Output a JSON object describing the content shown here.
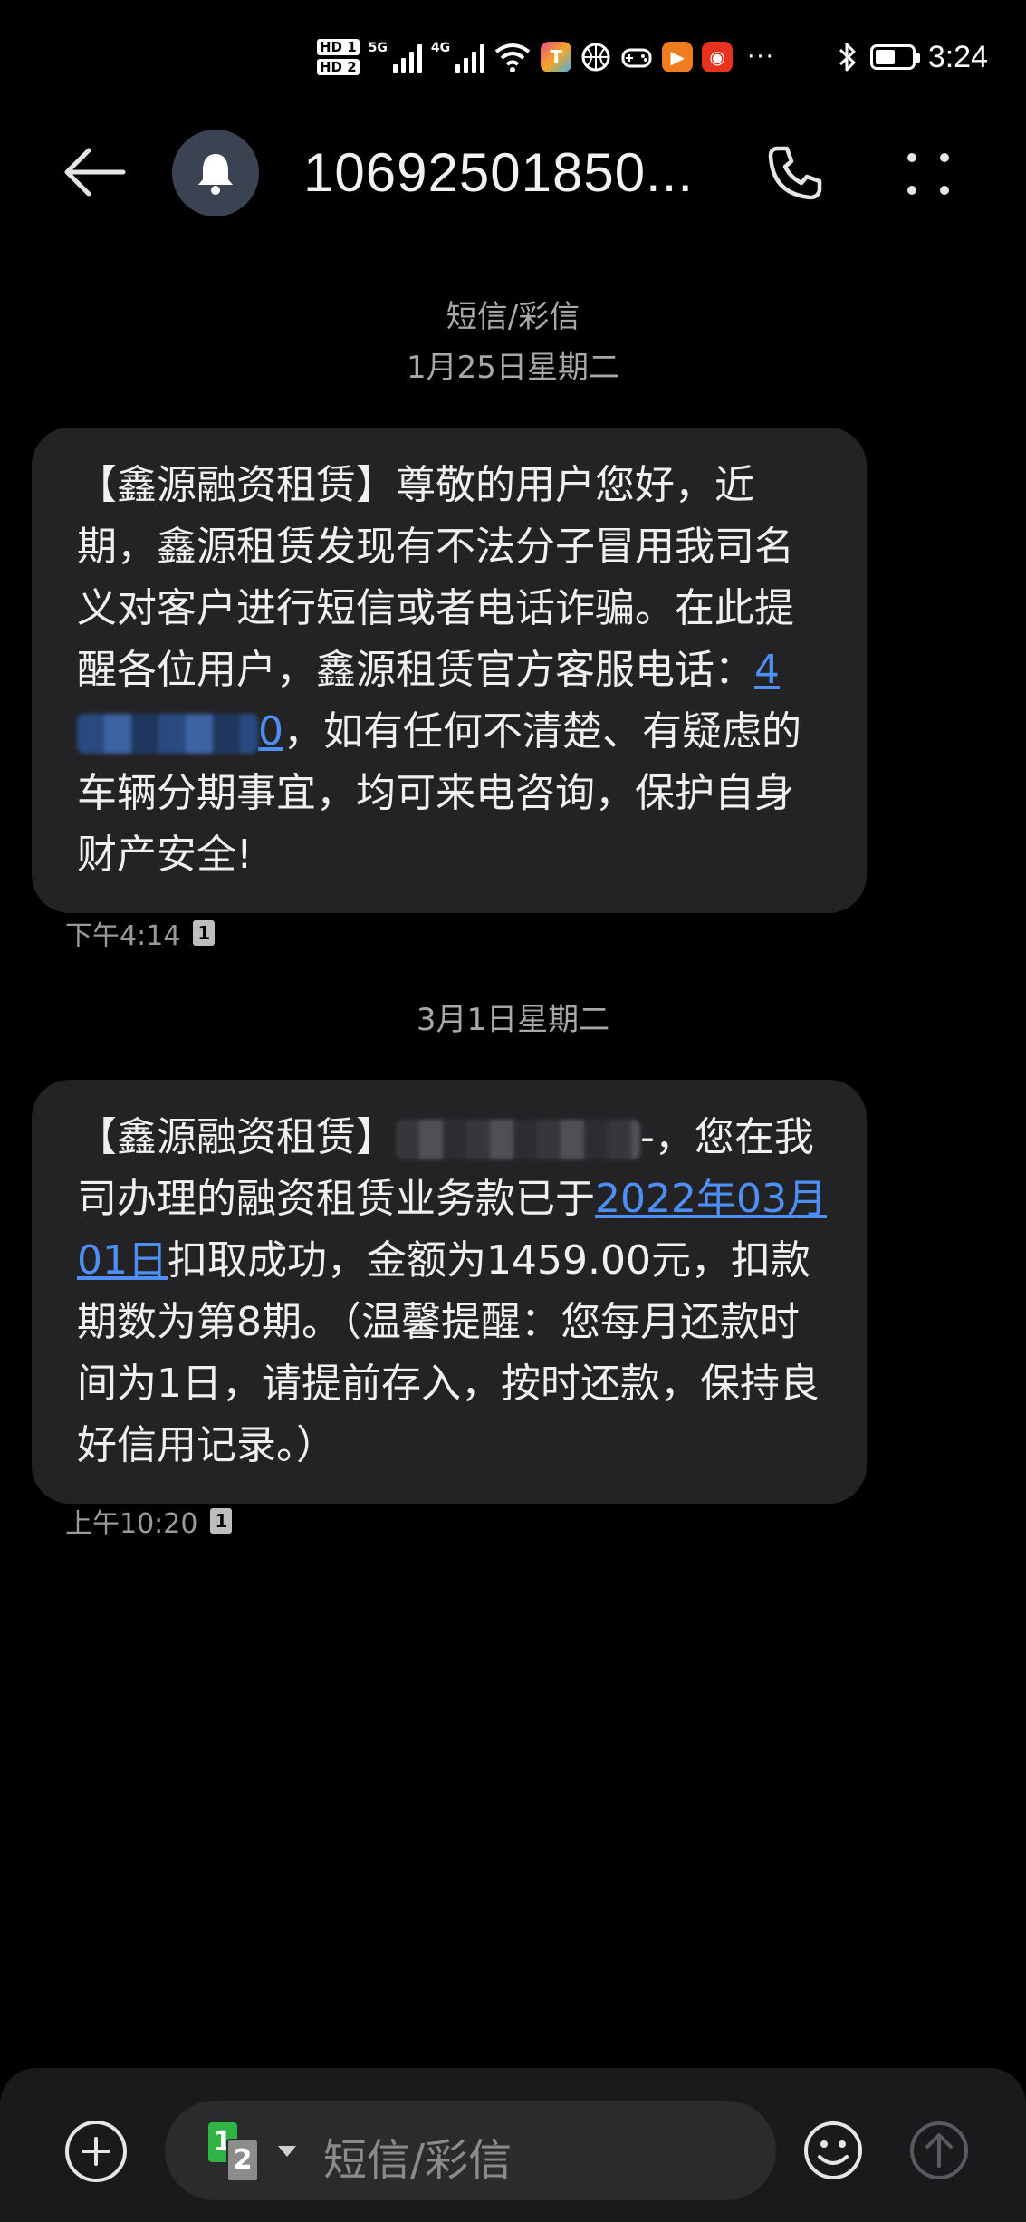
{
  "status_bar": {
    "hd1": "HD 1",
    "hd2": "HD 2",
    "net1": "5G",
    "net2": "4G",
    "more": "···",
    "time": "3:24",
    "battery_level": 0.55
  },
  "header": {
    "title": "10692501850..."
  },
  "thread": {
    "type_label": "短信/彩信",
    "day1": "1月25日星期二",
    "day2": "3月1日星期二"
  },
  "messages": [
    {
      "part1": "【鑫源融资租赁】尊敬的用户您好，近期，鑫源租赁发现有不法分子冒用我司名义对客户进行短信或者电话诈骗。在此提醒各位用户，鑫源租赁官方客服电话：",
      "link_visible_start": "4",
      "link_visible_end": "0",
      "part2": "，如有任何不清楚、有疑虑的车辆分期事宜，均可来电咨询，保护自身财产安全!",
      "time": "下午4:14",
      "sim": "1"
    },
    {
      "part1": "【鑫源融资租赁】",
      "redacted_tail": "-",
      "part2": "，您在我司办理的融资租赁业务款已于",
      "link": "2022年03月01日",
      "part3": "扣取成功，金额为1459.00元，扣款期数为第8期。（温馨提醒：您每月还款时间为1日，请提前存入，按时还款，保持良好信用记录。）",
      "time": "上午10:20",
      "sim": "1"
    }
  ],
  "composer": {
    "placeholder": "短信/彩信",
    "sim1": "1",
    "sim2": "2"
  },
  "colors": {
    "background": "#000000",
    "bubble": "#232326",
    "link": "#4d8ff5",
    "avatar": "#3b4352",
    "sim_active": "#2fb344"
  },
  "icons": [
    "back-arrow-icon",
    "bell-icon",
    "phone-icon",
    "more-icon",
    "add-icon",
    "emoji-icon",
    "send-icon",
    "bluetooth-icon",
    "battery-icon",
    "wifi-icon"
  ]
}
